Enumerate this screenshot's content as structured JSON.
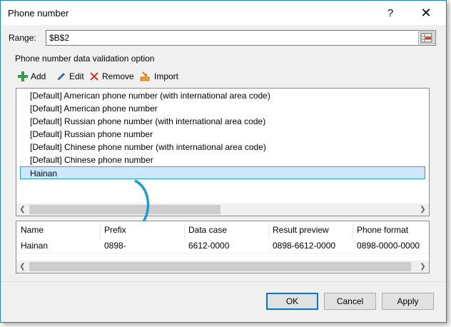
{
  "window": {
    "title": "Phone number",
    "help_glyph": "?",
    "close_glyph": "✕"
  },
  "range": {
    "label": "Range:",
    "value": "$B$2"
  },
  "group": {
    "legend": "Phone number data validation option"
  },
  "toolbar": {
    "add": "Add",
    "edit": "Edit",
    "remove": "Remove",
    "import": "Import"
  },
  "list": {
    "items": [
      "[Default] American phone number (with international area code)",
      "[Default] American phone number",
      "[Default] Russian phone number (with international area code)",
      "[Default] Russian phone number",
      "[Default] Chinese phone number (with international area code)",
      "[Default] Chinese phone number",
      "Hainan"
    ],
    "selected_index": 6
  },
  "table": {
    "columns": [
      "Name",
      "Prefix",
      "Data case",
      "Result preview",
      "Phone format"
    ],
    "rows": [
      [
        "Hainan",
        "0898-",
        "6612-0000",
        "0898-6612-0000",
        "0898-0000-0000"
      ]
    ]
  },
  "buttons": {
    "ok": "OK",
    "cancel": "Cancel",
    "apply": "Apply"
  },
  "colors": {
    "accent": "#0078d7",
    "selection_bg": "#cce8ff",
    "selection_border": "#26a0da",
    "arrow": "#1e9ad6",
    "add_icon": "#2ea043",
    "remove_icon": "#d9342b"
  },
  "icons": {
    "add": "plus-icon",
    "edit": "pencil-icon",
    "remove": "x-icon",
    "import": "import-icon",
    "range_picker": "range-select-icon",
    "annotation": "curved-arrow-icon"
  }
}
